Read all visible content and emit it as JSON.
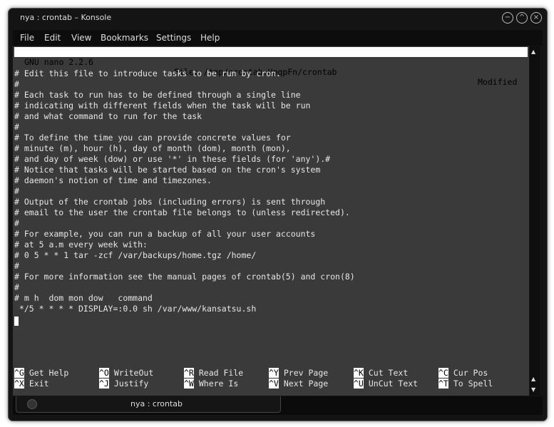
{
  "window": {
    "title": "nya : crontab – Konsole"
  },
  "menu": [
    "File",
    "Edit",
    "View",
    "Bookmarks",
    "Settings",
    "Help"
  ],
  "nano": {
    "version": "GNU nano 2.2.6",
    "file": "File: /tmp/crontab.UpqpFn/crontab",
    "status": "Modified"
  },
  "lines": [
    "",
    "# Edit this file to introduce tasks to be run by cron.",
    "#",
    "# Each task to run has to be defined through a single line",
    "# indicating with different fields when the task will be run",
    "# and what command to run for the task",
    "#",
    "# To define the time you can provide concrete values for",
    "# minute (m), hour (h), day of month (dom), month (mon),",
    "# and day of week (dow) or use '*' in these fields (for 'any').#",
    "# Notice that tasks will be started based on the cron's system",
    "# daemon's notion of time and timezones.",
    "#",
    "# Output of the crontab jobs (including errors) is sent through",
    "# email to the user the crontab file belongs to (unless redirected).",
    "#",
    "# For example, you can run a backup of all your user accounts",
    "# at 5 a.m every week with:",
    "# 0 5 * * 1 tar -zcf /var/backups/home.tgz /home/",
    "#",
    "# For more information see the manual pages of crontab(5) and cron(8)",
    "#",
    "# m h  dom mon dow   command",
    " */5 * * * * DISPLAY=:0.0 sh /var/www/kansatsu.sh"
  ],
  "shortcuts": [
    [
      {
        "key": "^G",
        "label": "Get Help"
      },
      {
        "key": "^O",
        "label": "WriteOut"
      },
      {
        "key": "^R",
        "label": "Read File"
      },
      {
        "key": "^Y",
        "label": "Prev Page"
      },
      {
        "key": "^K",
        "label": "Cut Text"
      },
      {
        "key": "^C",
        "label": "Cur Pos"
      }
    ],
    [
      {
        "key": "^X",
        "label": "Exit"
      },
      {
        "key": "^J",
        "label": "Justify"
      },
      {
        "key": "^W",
        "label": "Where Is"
      },
      {
        "key": "^V",
        "label": "Next Page"
      },
      {
        "key": "^U",
        "label": "UnCut Text"
      },
      {
        "key": "^T",
        "label": "To Spell"
      }
    ]
  ],
  "tab": {
    "label": "nya : crontab"
  }
}
